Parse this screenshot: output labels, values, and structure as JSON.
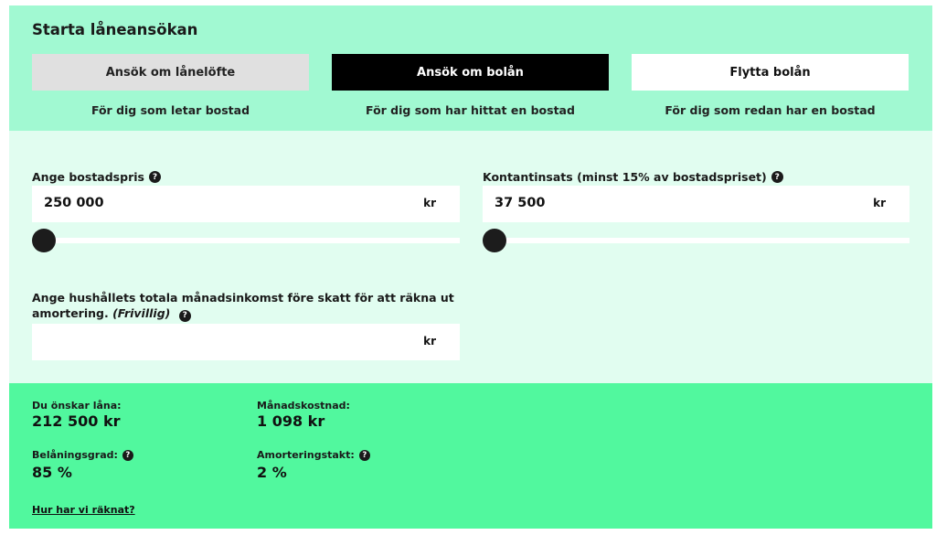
{
  "header": {
    "title": "Starta låneansökan",
    "tabs": [
      {
        "label": "Ansök om lånelöfte",
        "subtitle": "För dig som letar bostad"
      },
      {
        "label": "Ansök om bolån",
        "subtitle": "För dig som har hittat en bostad"
      },
      {
        "label": "Flytta bolån",
        "subtitle": "För dig som redan har en bostad"
      }
    ],
    "selected_tab": "Ansök om bolån"
  },
  "form": {
    "price": {
      "label": "Ange bostadspris",
      "value": "250 000",
      "unit": "kr",
      "slider_level": 0
    },
    "deposit": {
      "label": "Kontantinsats (minst 15% av bostadspriset)",
      "value": "37 500",
      "unit": "kr",
      "slider_level": 0
    },
    "income": {
      "label": "Ange hushållets totala månadsinkomst före skatt för att räkna ut amortering.",
      "optional": "(Frivillig)",
      "value": "",
      "unit": "kr"
    },
    "help_glyph": "?"
  },
  "results": {
    "loan_label": "Du önskar låna:",
    "loan_value": "212 500 kr",
    "monthly_label": "Månadskostnad:",
    "monthly_value": "1 098 kr",
    "ltv_label": "Belåningsgrad:",
    "ltv_value": "85 %",
    "amort_label": "Amorteringstakt:",
    "amort_value": "2 %",
    "link": "Hur har vi räknat?"
  },
  "colors": {
    "header_bg": "#a1f9d2",
    "form_bg": "#e1fdf0",
    "results_bg": "#51f89e",
    "selected_tab_bg": "#000000",
    "unselected_tab_bg": "#e0e0e0"
  }
}
